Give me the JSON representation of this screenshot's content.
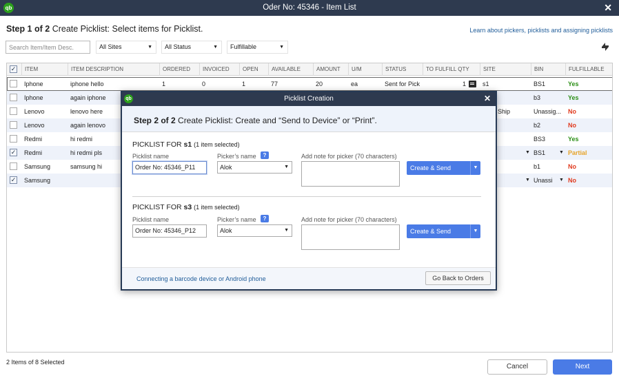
{
  "window": {
    "title": "Oder No: 45346 - Item List",
    "logo": "qb"
  },
  "step": {
    "bold": "Step 1 of 2",
    "rest": " Create Picklist: Select items for Picklist."
  },
  "learn_link": "Learn about pickers, picklists and assigning picklists",
  "filters": {
    "search_placeholder": "Search Item/Item Desc.",
    "sites": "All Sites",
    "status": "All Status",
    "fulfillable": "Fulfillable"
  },
  "table": {
    "headers": [
      "ITEM",
      "ITEM DESCRIPTION",
      "ORDERED",
      "INVOICED",
      "OPEN",
      "AVAILABLE",
      "AMOUNT",
      "U/M",
      "STATUS",
      "TO FULFILL QTY",
      "SITE",
      "BIN",
      "FULFILLABLE"
    ],
    "rows": [
      {
        "checked": false,
        "item": "Iphone",
        "desc": "iphone hello",
        "ordered": "1",
        "invoiced": "0",
        "open": "1",
        "available": "77",
        "amount": "20",
        "um": "ea",
        "status": "Sent for Pick",
        "qty": "1",
        "site": "s1",
        "bin": "BS1",
        "fulfillable": "Yes"
      },
      {
        "checked": false,
        "item": "Iphone",
        "desc": "again iphone",
        "site": "",
        "bin": "b3",
        "fulfillable": "Yes"
      },
      {
        "checked": false,
        "item": "Lenovo",
        "desc": "lenovo here",
        "site": "Ship",
        "bin": "Unassig...",
        "fulfillable": "No"
      },
      {
        "checked": false,
        "item": "Lenovo",
        "desc": "again lenovo",
        "site": "",
        "bin": "b2",
        "fulfillable": "No"
      },
      {
        "checked": false,
        "item": "Redmi",
        "desc": "hi redmi",
        "site": "",
        "bin": "BS3",
        "fulfillable": "Yes"
      },
      {
        "checked": true,
        "item": "Redmi",
        "desc": "hi redmi pls",
        "site": "",
        "bin": "BS1",
        "fulfillable": "Partial"
      },
      {
        "checked": false,
        "item": "Samsung",
        "desc": "samsung hi",
        "site": "",
        "bin": "b1",
        "fulfillable": "No"
      },
      {
        "checked": true,
        "item": "Samsung",
        "desc": "",
        "site": "",
        "bin": "Unassi",
        "fulfillable": "No"
      }
    ]
  },
  "footer": {
    "count": "2 Items of 8 Selected",
    "cancel": "Cancel",
    "next": "Next"
  },
  "modal": {
    "title": "Picklist Creation",
    "step_bold": "Step 2 of 2",
    "step_rest": " Create Picklist: Create and “Send to Device” or “Print”.",
    "labels": {
      "picklist_name": "Picklist name",
      "pickers_name": "Picker’s name",
      "note": "Add note for picker (70 characters)",
      "create_send": "Create & Send"
    },
    "sections": [
      {
        "prefix": "PICKLIST FOR ",
        "site": "s1",
        "count": "(1 item selected)",
        "name": "Order No: 45346_P11",
        "picker": "Alok"
      },
      {
        "prefix": "PICKLIST FOR ",
        "site": "s3",
        "count": "(1 item selected)",
        "name": "Order No: 45346_P12",
        "picker": "Alok"
      }
    ],
    "footer_link": "Connecting a barcode device or Android phone",
    "back_button": "Go Back to Orders"
  },
  "colors": {
    "titlebar": "#2e3a4f",
    "accent": "#4a7be6",
    "yes": "#2c8f17",
    "no": "#e03a1e",
    "partial": "#e7a42a"
  }
}
